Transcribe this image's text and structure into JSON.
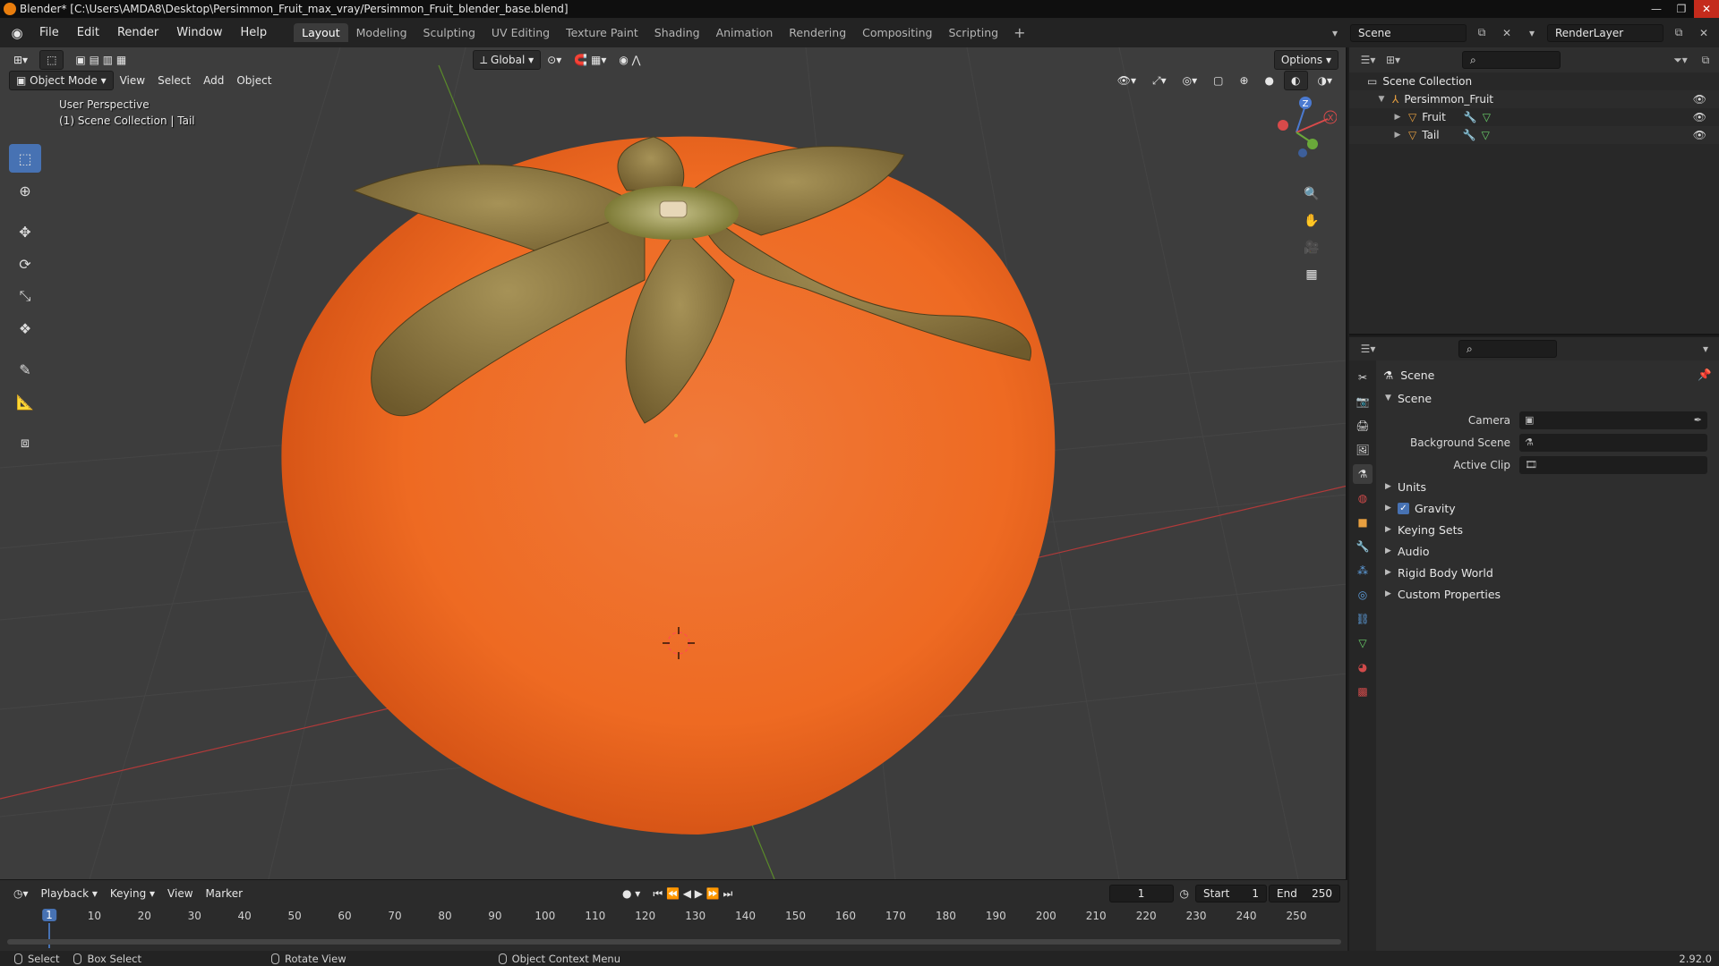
{
  "window": {
    "title": "Blender* [C:\\Users\\AMDA8\\Desktop\\Persimmon_Fruit_max_vray/Persimmon_Fruit_blender_base.blend]"
  },
  "menu": [
    "File",
    "Edit",
    "Render",
    "Window",
    "Help"
  ],
  "workspaces": [
    "Layout",
    "Modeling",
    "Sculpting",
    "UV Editing",
    "Texture Paint",
    "Shading",
    "Animation",
    "Rendering",
    "Compositing",
    "Scripting"
  ],
  "active_workspace": "Layout",
  "scene_selector": {
    "scene": "Scene",
    "view_layer": "RenderLayer"
  },
  "viewport": {
    "mode": "Object Mode",
    "menus": [
      "View",
      "Select",
      "Add",
      "Object"
    ],
    "transform_orientation": "Global",
    "options": "Options",
    "info_line1": "User Perspective",
    "info_line2": "(1) Scene Collection | Tail",
    "gizmo_axes": {
      "z": "Z",
      "x": "X"
    },
    "object_colors": {
      "fruit": "#ef6a1e",
      "calyx": "#8f7a3c"
    }
  },
  "timeline": {
    "menus": [
      "Playback",
      "Keying",
      "View",
      "Marker"
    ],
    "current_frame": "1",
    "start_label": "Start",
    "start": "1",
    "end_label": "End",
    "end": "250",
    "ruler": [
      "1",
      "10",
      "20",
      "30",
      "40",
      "50",
      "60",
      "70",
      "80",
      "90",
      "100",
      "110",
      "120",
      "130",
      "140",
      "150",
      "160",
      "170",
      "180",
      "190",
      "200",
      "210",
      "220",
      "230",
      "240",
      "250"
    ]
  },
  "statusbar": {
    "select": "Select",
    "box_select": "Box Select",
    "rotate_view": "Rotate View",
    "context_menu": "Object Context Menu",
    "version": "2.92.0"
  },
  "outliner": {
    "root": "Scene Collection",
    "collection": "Persimmon_Fruit",
    "objects": [
      "Fruit",
      "Tail"
    ]
  },
  "properties": {
    "context": "Scene",
    "panel": "Scene",
    "fields": [
      {
        "label": "Camera"
      },
      {
        "label": "Background Scene"
      },
      {
        "label": "Active Clip"
      }
    ],
    "subpanels": [
      "Units",
      "Gravity",
      "Keying Sets",
      "Audio",
      "Rigid Body World",
      "Custom Properties"
    ],
    "gravity_checked": true
  }
}
